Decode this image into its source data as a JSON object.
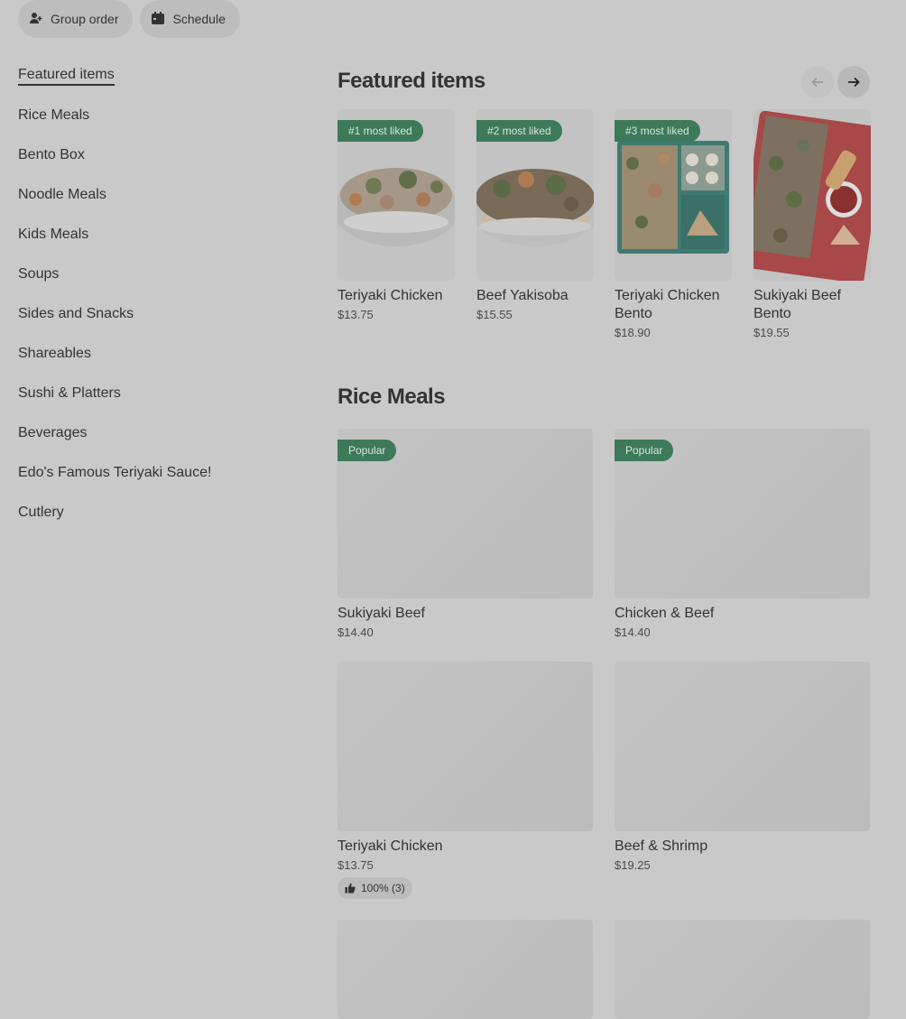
{
  "topbar": {
    "group_order": "Group order",
    "schedule": "Schedule"
  },
  "sidebar": {
    "items": [
      {
        "label": "Featured items"
      },
      {
        "label": "Rice Meals"
      },
      {
        "label": "Bento Box"
      },
      {
        "label": "Noodle Meals"
      },
      {
        "label": "Kids Meals"
      },
      {
        "label": "Soups"
      },
      {
        "label": "Sides and Snacks"
      },
      {
        "label": "Shareables"
      },
      {
        "label": "Sushi & Platters"
      },
      {
        "label": "Beverages"
      },
      {
        "label": "Edo's Famous Teriyaki Sauce!"
      },
      {
        "label": "Cutlery"
      }
    ]
  },
  "featured": {
    "title": "Featured items",
    "cards": [
      {
        "badge": "#1 most liked",
        "name": "Teriyaki Chicken",
        "price": "$13.75"
      },
      {
        "badge": "#2 most liked",
        "name": "Beef Yakisoba",
        "price": "$15.55"
      },
      {
        "badge": "#3 most liked",
        "name": "Teriyaki Chicken Bento",
        "price": "$18.90"
      },
      {
        "badge": "",
        "name": "Sukiyaki Beef Bento",
        "price": "$19.55"
      }
    ]
  },
  "rice": {
    "title": "Rice Meals",
    "cards": [
      {
        "badge": "Popular",
        "name": "Sukiyaki Beef",
        "price": "$14.40"
      },
      {
        "badge": "Popular",
        "name": "Chicken & Beef",
        "price": "$14.40"
      },
      {
        "badge": "",
        "name": "Teriyaki Chicken",
        "price": "$13.75",
        "rating": "100% (3)"
      },
      {
        "badge": "",
        "name": "Beef & Shrimp",
        "price": "$19.25"
      }
    ]
  },
  "colors": {
    "badge_green": "#3d7a5a",
    "overlay": "#c9c9c9"
  }
}
